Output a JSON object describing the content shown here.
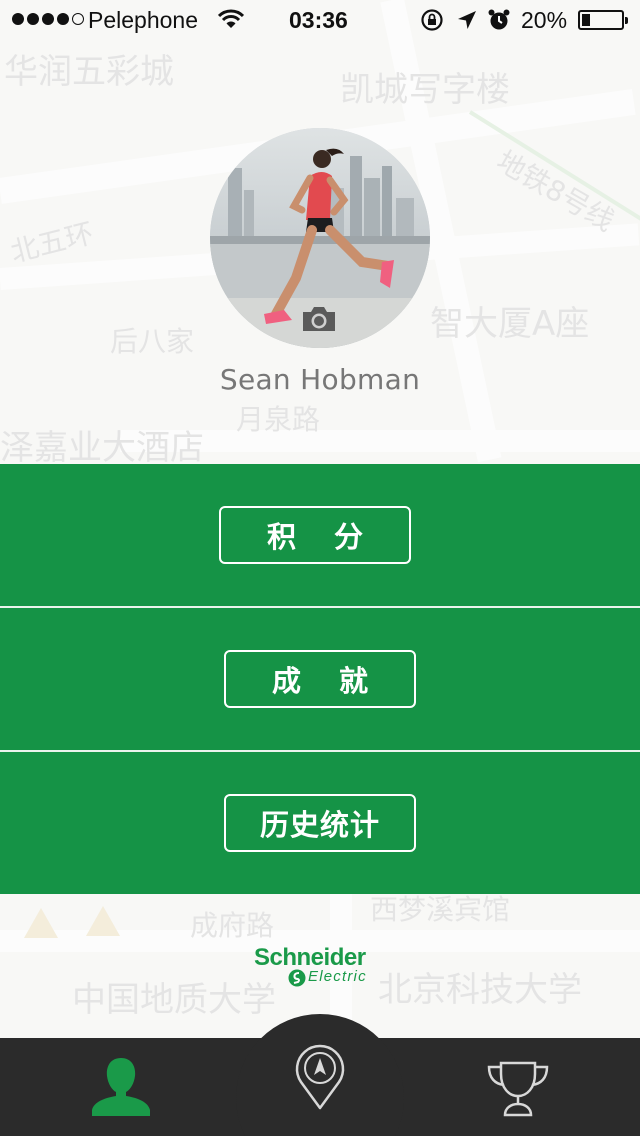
{
  "status_bar": {
    "carrier": "Pelephone",
    "time": "03:36",
    "battery_percent_label": "20%",
    "battery_level": 0.2,
    "signal_bars_filled": 4,
    "signal_bars_total": 5
  },
  "map": {
    "labels": [
      "华润五彩城",
      "凯城写字楼",
      "地铁8号线",
      "北五环",
      "后八家",
      "智大厦A座",
      "月泉路",
      "泽嘉业大酒店",
      "成府路",
      "西梦溪宾馆",
      "中国地质大学",
      "北京科技大学"
    ]
  },
  "profile": {
    "name": "Sean Hobman",
    "avatar_icon": "runner-photo",
    "camera_icon": "camera-icon"
  },
  "menu": {
    "items": [
      {
        "label": "积分"
      },
      {
        "label": "成就"
      },
      {
        "label": "历史统计"
      }
    ]
  },
  "brand": {
    "name": "Schneider",
    "sub": "Electric"
  },
  "tab_bar": {
    "items": [
      {
        "icon": "person-icon",
        "active": true
      },
      {
        "icon": "navigation-pin-icon",
        "active": false
      },
      {
        "icon": "trophy-icon",
        "active": false
      }
    ]
  },
  "colors": {
    "accent_green": "#159346",
    "tab_bar": "#2b2b2b",
    "tab_active": "#1a9a49",
    "tab_inactive": "#d8d8d8"
  }
}
